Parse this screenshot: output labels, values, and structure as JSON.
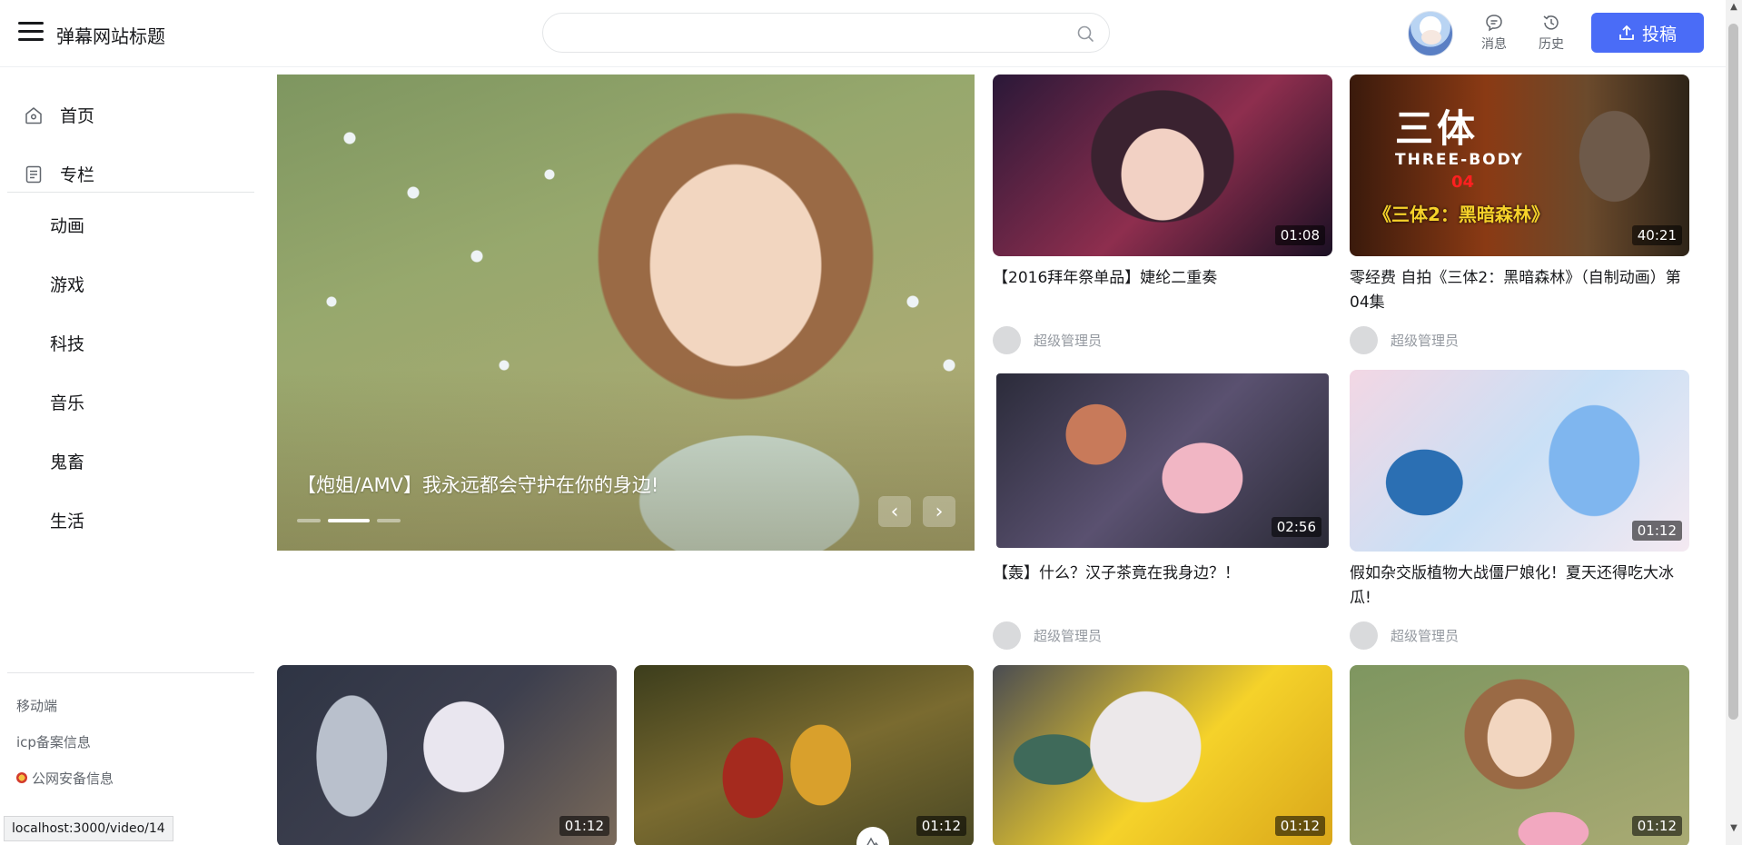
{
  "header": {
    "title": "弹幕网站标题",
    "search_placeholder": "",
    "messages_label": "消息",
    "history_label": "历史",
    "upload_label": "投稿"
  },
  "sidebar": {
    "main_items": [
      {
        "label": "首页",
        "icon": "home-icon"
      },
      {
        "label": "专栏",
        "icon": "article-icon"
      }
    ],
    "categories": [
      "动画",
      "游戏",
      "科技",
      "音乐",
      "鬼畜",
      "生活"
    ],
    "footer_links": [
      "移动端",
      "icp备案信息",
      "公网安备信息"
    ]
  },
  "status_bar": "localhost:3000/video/14",
  "carousel": {
    "title": "【炮姐/AMV】我永远都会守护在你的身边!",
    "slide_count": 3,
    "active_slide": 2
  },
  "videos": [
    {
      "title": "【2016拜年祭单品】婕纶二重奏",
      "duration": "01:08",
      "author": "超级管理员"
    },
    {
      "title": "零经费 自拍《三体2：黑暗森林》（自制动画）第04集",
      "duration": "40:21",
      "author": "超级管理员",
      "thumb_text": {
        "title": "三体",
        "subtitle": "THREE-BODY",
        "episode": "04",
        "caption": "《三体2：黑暗森林》"
      }
    },
    {
      "title": "【轰】什么？汉子茶竟在我身边？！",
      "duration": "02:56",
      "author": "超级管理员"
    },
    {
      "title": "假如杂交版植物大战僵尸娘化！夏天还得吃大冰瓜!",
      "duration": "01:12",
      "author": "超级管理员"
    },
    {
      "title": "",
      "duration": "01:12",
      "author": ""
    },
    {
      "title": "",
      "duration": "01:12",
      "author": ""
    },
    {
      "title": "",
      "duration": "01:12",
      "author": ""
    },
    {
      "title": "",
      "duration": "01:12",
      "author": ""
    }
  ],
  "colors": {
    "accent": "#4a6cf7",
    "text": "#18191c",
    "muted": "#9499a0"
  }
}
